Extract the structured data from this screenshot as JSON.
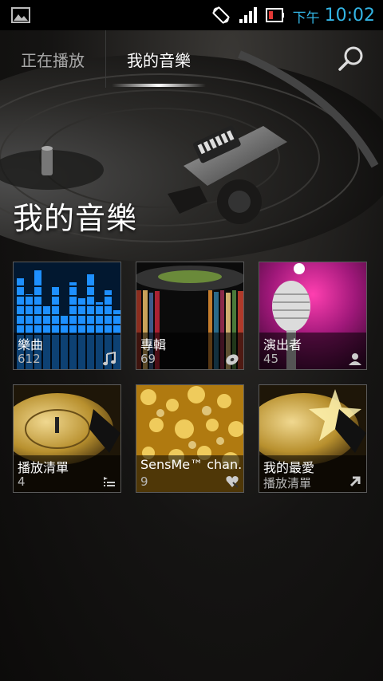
{
  "status_bar": {
    "ampm": "下午",
    "time": "10:02",
    "icons": [
      "image-icon",
      "rotate-icon",
      "signal-icon",
      "battery-icon"
    ]
  },
  "tabs": [
    {
      "label": "正在播放",
      "active": false
    },
    {
      "label": "我的音樂",
      "active": true
    }
  ],
  "search": {
    "icon": "search-icon"
  },
  "page_title": "我的音樂",
  "tiles": [
    {
      "label": "樂曲",
      "count": "612",
      "icon": "music-note-icon"
    },
    {
      "label": "專輯",
      "count": "69",
      "icon": "disc-icon"
    },
    {
      "label": "演出者",
      "count": "45",
      "icon": "person-icon"
    },
    {
      "label": "播放清單",
      "count": "4",
      "icon": "playlist-icon"
    },
    {
      "label": "SensMe™ chan...",
      "count": "9",
      "icon": "heart-icon"
    },
    {
      "label": "我的最愛",
      "count": "播放清單",
      "icon": "shortcut-icon"
    }
  ],
  "colors": {
    "accent": "#33b5e5",
    "background": "#121110"
  }
}
